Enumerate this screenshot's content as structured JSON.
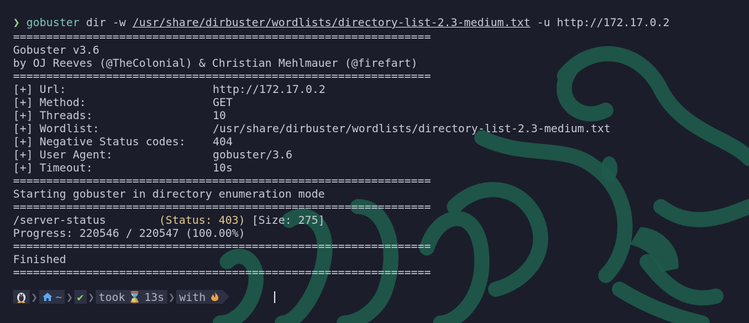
{
  "command": {
    "prompt_symbol": "❯",
    "program": "gobuster",
    "args_before": " dir -w ",
    "wordlist_arg": "/usr/share/dirbuster/wordlists/directory-list-2.3-medium.txt",
    "args_after": " -u http://172.17.0.2"
  },
  "separator": "===============================================================",
  "banner": {
    "title": "Gobuster v3.6",
    "authors": "by OJ Reeves (@TheColonial) & Christian Mehlmauer (@firefart)"
  },
  "config": [
    {
      "key": "[+] Url:",
      "value": "http://172.17.0.2"
    },
    {
      "key": "[+] Method:",
      "value": "GET"
    },
    {
      "key": "[+] Threads:",
      "value": "10"
    },
    {
      "key": "[+] Wordlist:",
      "value": "/usr/share/dirbuster/wordlists/directory-list-2.3-medium.txt"
    },
    {
      "key": "[+] Negative Status codes:",
      "value": "404"
    },
    {
      "key": "[+] User Agent:",
      "value": "gobuster/3.6"
    },
    {
      "key": "[+] Timeout:",
      "value": "10s"
    }
  ],
  "mode_message": "Starting gobuster in directory enumeration mode",
  "result": {
    "path": "/server-status        ",
    "status": "(Status: 403)",
    "size": " [Size: 275]"
  },
  "progress": "Progress: 220546 / 220547 (100.00%)",
  "finished": "Finished",
  "prompt_bar": {
    "os_icon": "linux-penguin-icon",
    "home_symbol": "~",
    "took_label": "took",
    "duration": "13s",
    "with_label": "with"
  },
  "colors": {
    "background": "#1b1d2b",
    "text": "#c9cdd6",
    "status": "#e5c890",
    "command": "#81c8be",
    "prompt": "#a6d189",
    "wallpaper": "#1f5c4c"
  }
}
